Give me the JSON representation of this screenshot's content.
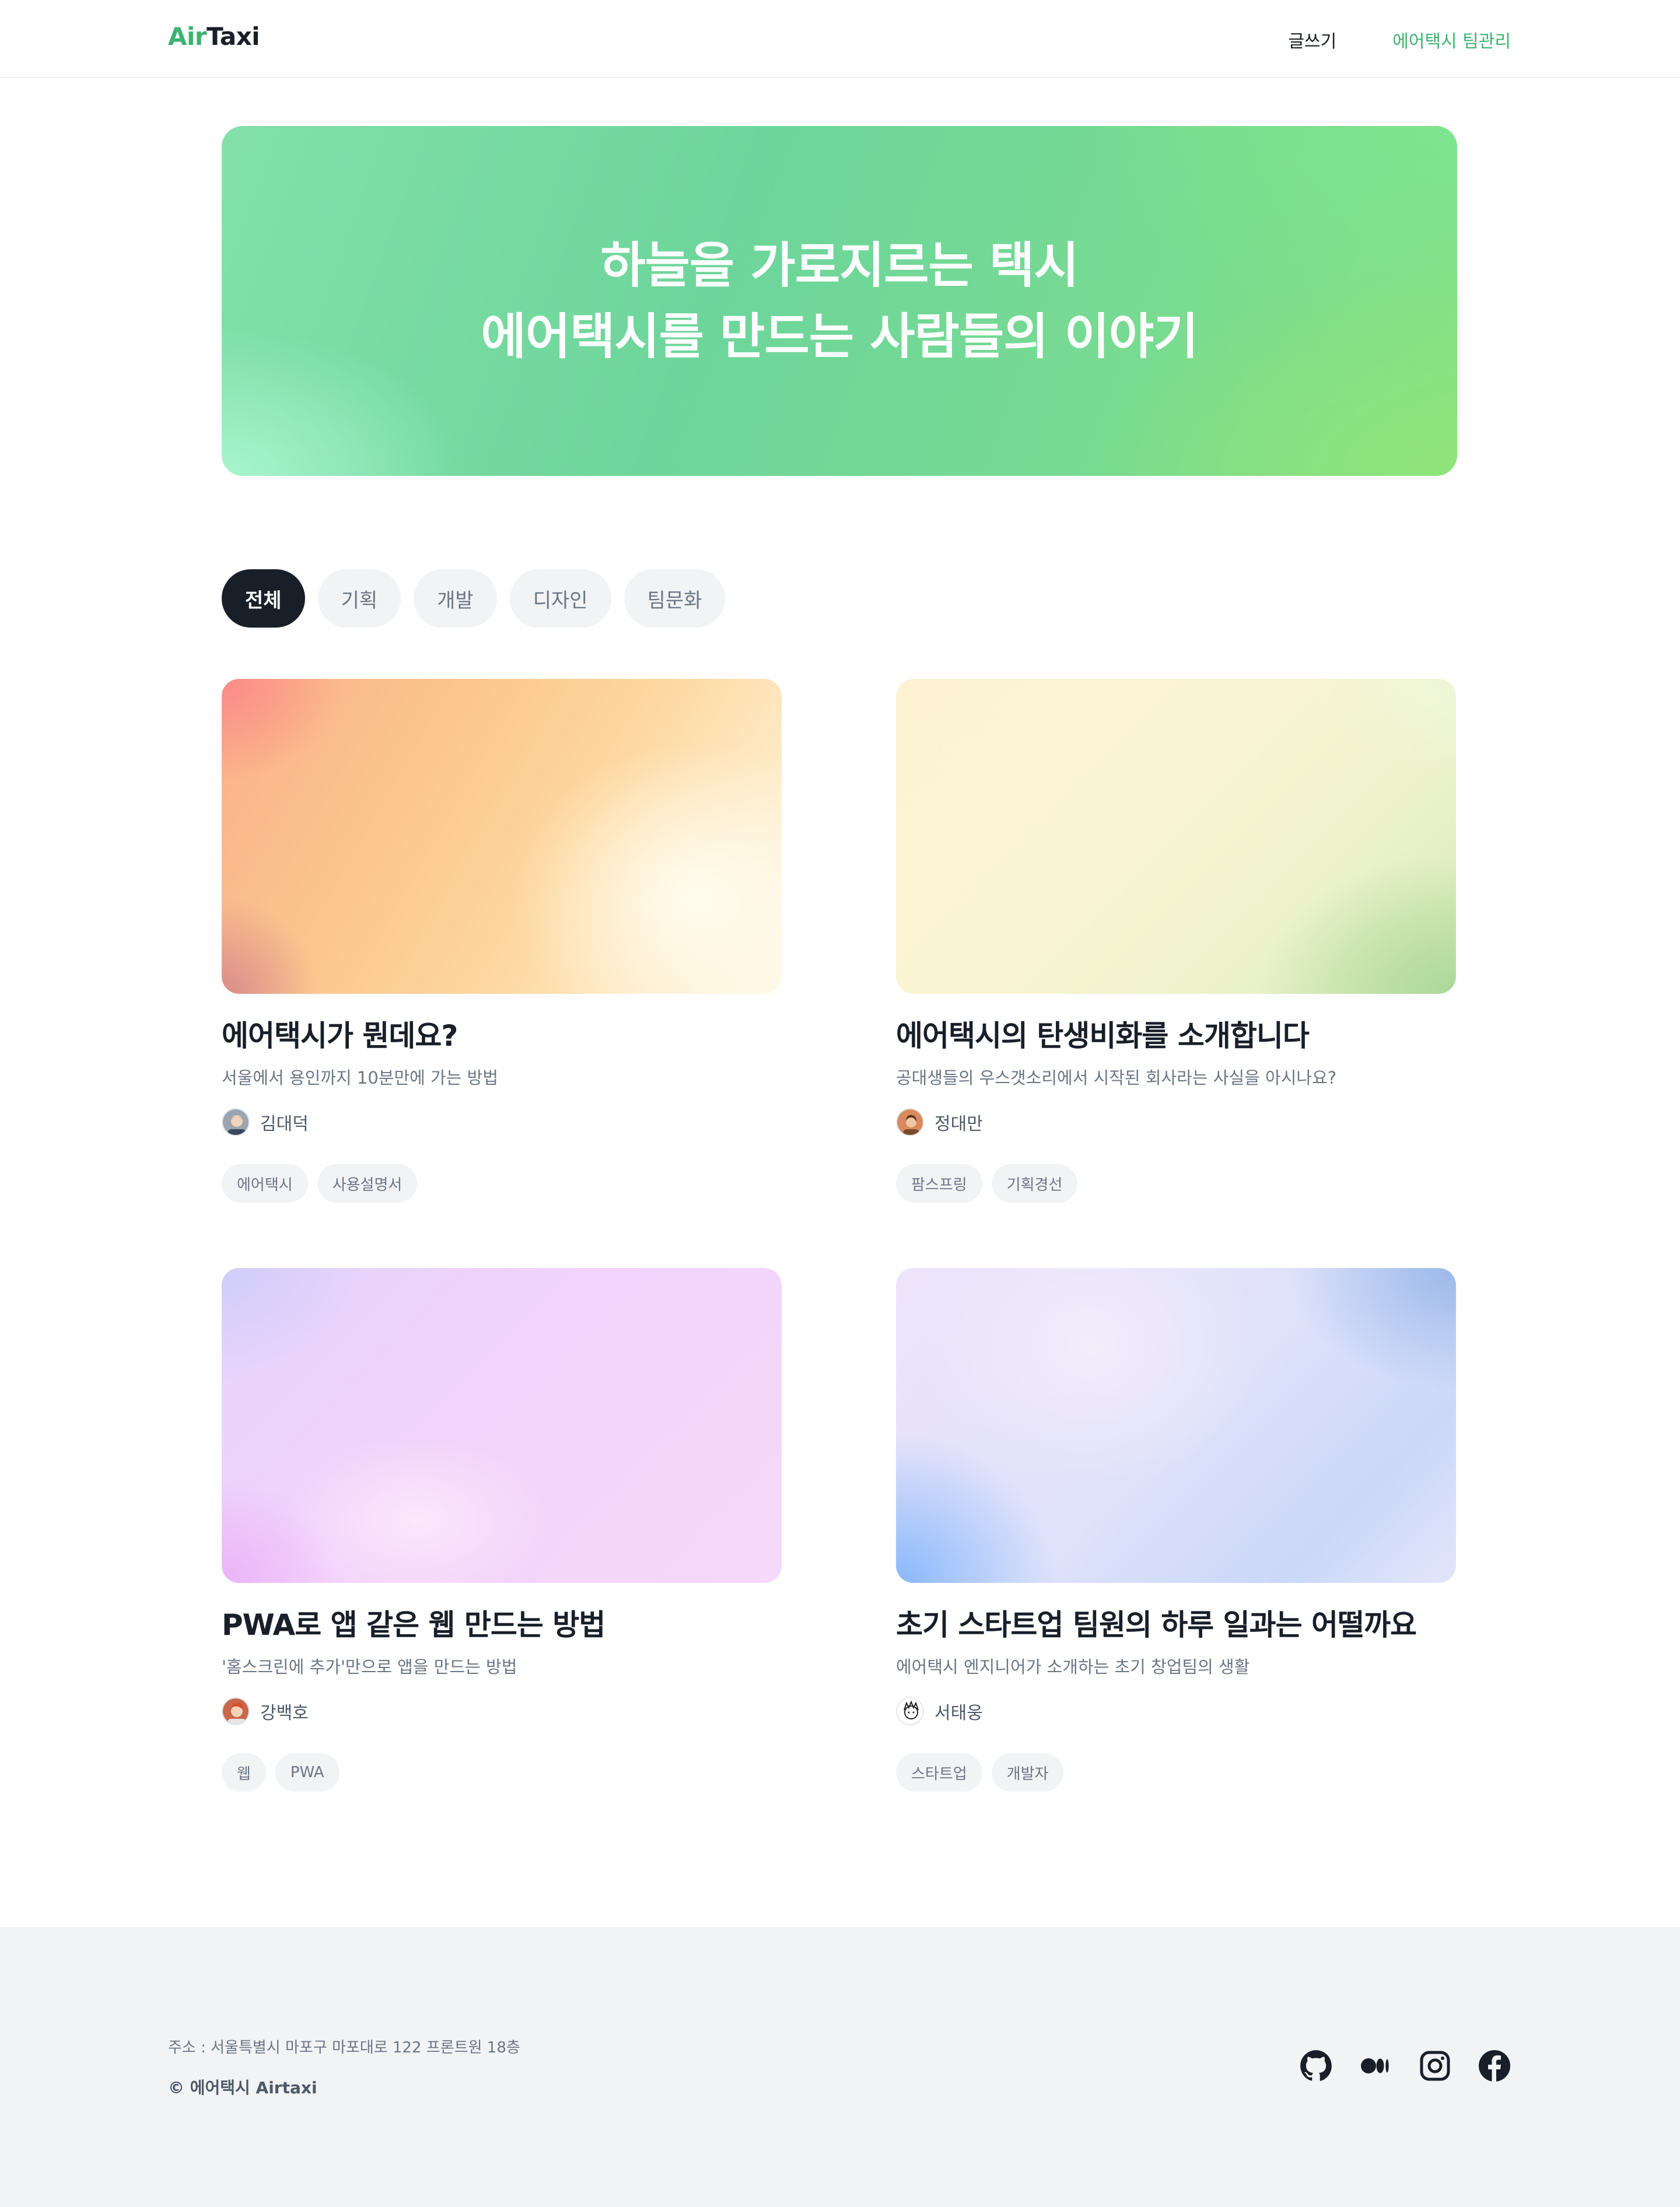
{
  "header": {
    "logo_air": "Air",
    "logo_taxi": "Taxi",
    "nav": {
      "write": "글쓰기",
      "team": "에어택시 팀관리"
    }
  },
  "hero": {
    "line1": "하늘을 가로지르는 택시",
    "line2": "에어택시를 만드는 사람들의 이야기"
  },
  "filters": [
    "전체",
    "기획",
    "개발",
    "디자인",
    "팀문화"
  ],
  "active_filter": "전체",
  "posts": [
    {
      "title": "에어택시가 뭔데요?",
      "subtitle": "서울에서 용인까지 10분만에 가는 방법",
      "author": "김대덕",
      "tags": [
        "에어택시",
        "사용설명서"
      ]
    },
    {
      "title": "에어택시의 탄생비화를 소개합니다",
      "subtitle": "공대생들의 우스갯소리에서 시작된 회사라는 사실을 아시나요?",
      "author": "정대만",
      "tags": [
        "팜스프링",
        "기획경선"
      ]
    },
    {
      "title": "PWA로 앱 같은 웹 만드는 방법",
      "subtitle": "'홈스크린에 추가'만으로 앱을 만드는 방법",
      "author": "강백호",
      "tags": [
        "웹",
        "PWA"
      ]
    },
    {
      "title": "초기 스타트업 팀원의 하루 일과는 어떨까요",
      "subtitle": "에어택시 엔지니어가 소개하는 초기 창업팀의 생활",
      "author": "서태웅",
      "tags": [
        "스타트업",
        "개발자"
      ]
    }
  ],
  "footer": {
    "address": "주소 : 서울특별시 마포구 마포대로 122 프론트원 18층",
    "copyright": "© 에어택시 Airtaxi",
    "socials": [
      "github-icon",
      "medium-icon",
      "instagram-icon",
      "facebook-icon"
    ]
  },
  "colors": {
    "brand": "#3cb371",
    "text": "#191f28",
    "muted": "#6b7684",
    "chip_bg": "#f2f3f5",
    "footer_bg": "#f2f3f5"
  }
}
